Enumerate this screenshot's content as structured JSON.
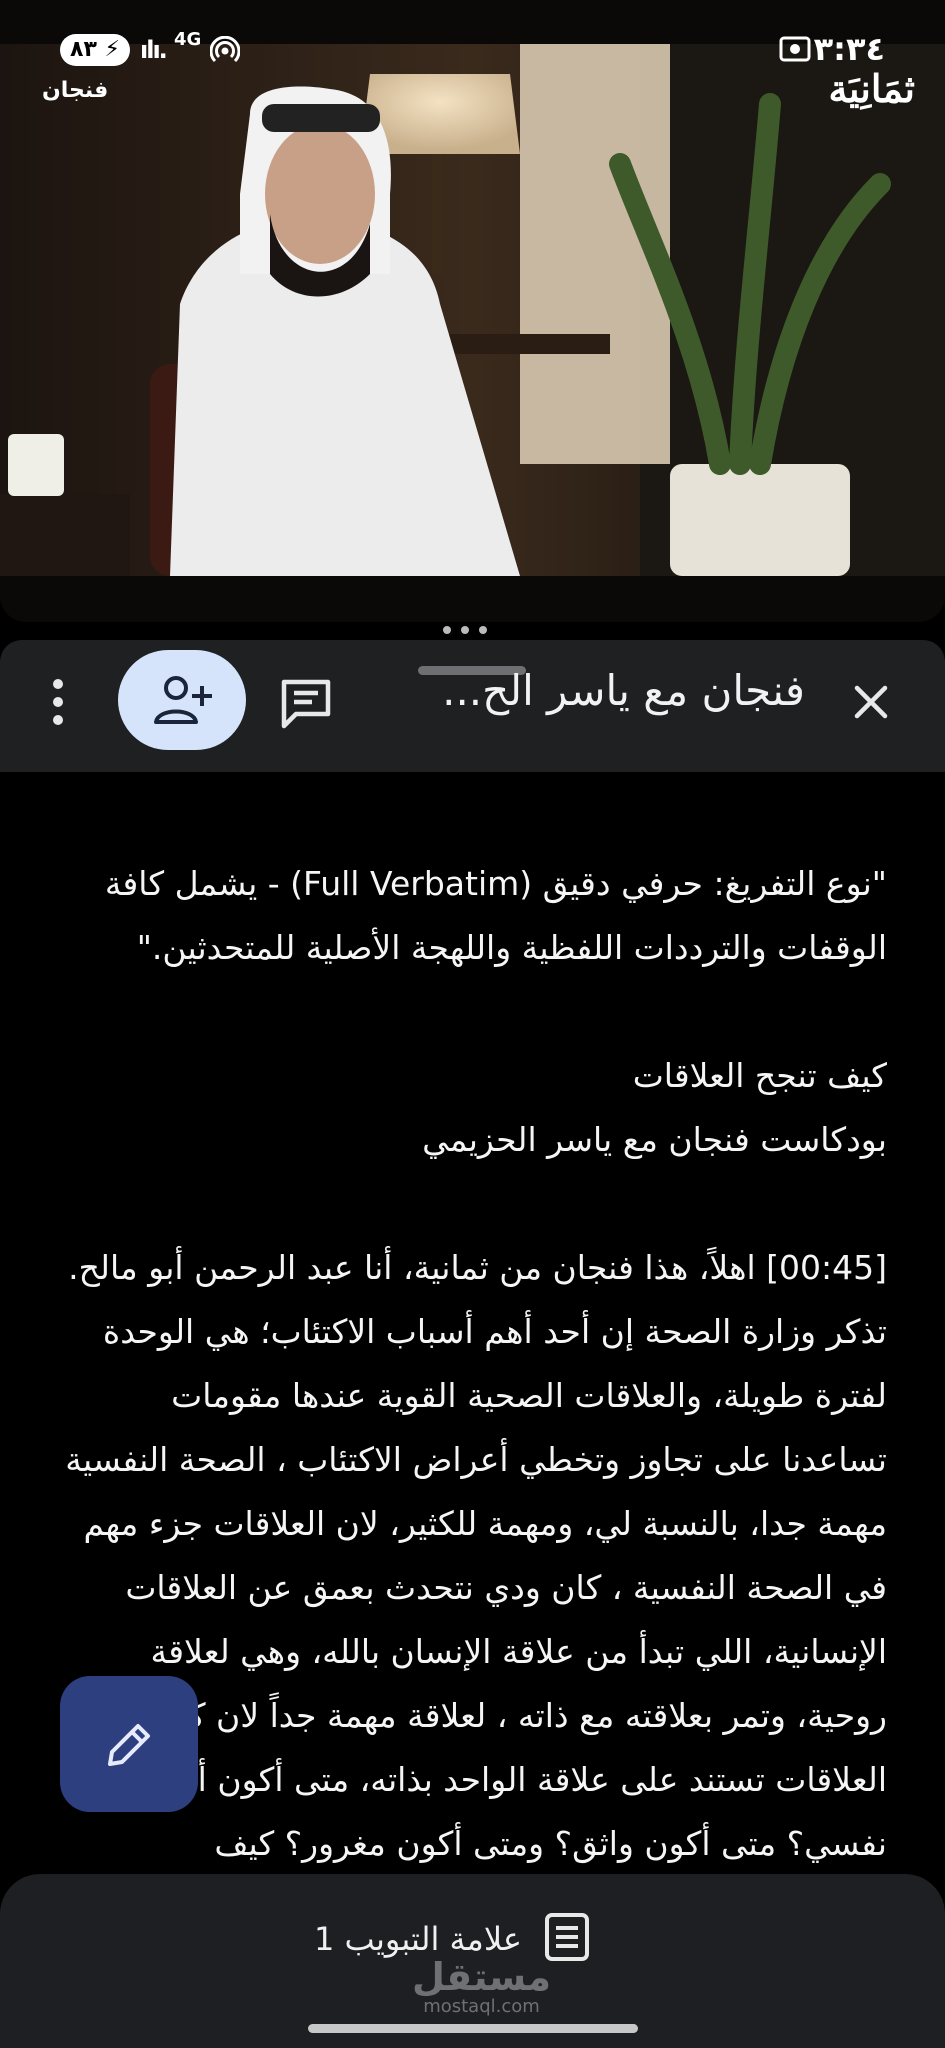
{
  "status": {
    "time": "٣:٣٤",
    "battery": "٨٣",
    "network": "4G"
  },
  "video": {
    "brand_small": "فنجان",
    "brand_logo": "ثمَانِيَة"
  },
  "header": {
    "title": "فنجان مع ياسر الح...",
    "icons": [
      "close-icon",
      "comment-icon",
      "person-add-icon",
      "more-vert-icon"
    ]
  },
  "document": {
    "lines": [
      "\"نوع التفريغ: حرفي دقيق (Full Verbatim) - يشمل كافة الوقفات والترددات اللفظية واللهجة الأصلية للمتحدثين.\"",
      "",
      "كيف تنجح العلاقات",
      "بودكاست فنجان مع ياسر الحزيمي",
      "",
      "[00:45]  اهلاً، هذا فنجان من ثمانية، أنا عبد الرحمن أبو مالح.",
      "تذكر وزارة الصحة إن أحد أهم أسباب الاكتئاب؛ هي الوحدة لفترة طويلة، والعلاقات الصحية القوية عندها مقومات تساعدنا على تجاوز وتخطي أعراض الاكتئاب ، الصحة النفسية مهمة جدا،  بالنسبة لي، ومهمة للكثير، لان العلاقات جزء مهم في الصحة النفسية ، كان ودي نتحدث بعمق عن العلاقات الإنسانية، اللي تبدأ من علاقة الإنسان بالله، وهي لعلاقة روحية، وتمر بعلاقته مع ذاته ، لعلاقة مهمة جداً لان كل العلاقات تستند على علاقة الواحد بذاته، متى أكون أحب نفسي؟ متى أكون واثق؟ ومتى أكون مغرور؟ كيف"
    ]
  },
  "bottom": {
    "bookmark_label": "علامة التبويب 1",
    "watermark_ar": "مستقل",
    "watermark_en": "mostaql.com"
  }
}
